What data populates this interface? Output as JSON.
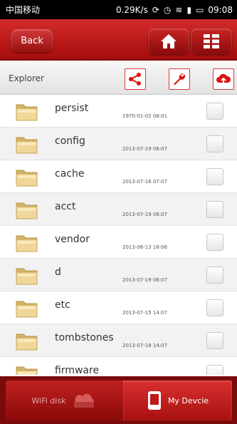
{
  "status_bar": {
    "carrier": "中国移动",
    "net_speed": "0.29K/s",
    "time": "09:08"
  },
  "header": {
    "back_label": "Back",
    "home_icon": "home-icon",
    "grid_icon": "grid-icon"
  },
  "toolbar": {
    "title": "Explorer",
    "share_icon": "share-icon",
    "tools_icon": "wrench-icon",
    "upload_icon": "cloud-upload-icon"
  },
  "files": [
    {
      "name": "persist",
      "date": "1970-01-02 08:01"
    },
    {
      "name": "config",
      "date": "2013-07-19 06:07"
    },
    {
      "name": "cache",
      "date": "2013-07-16 07:07"
    },
    {
      "name": "acct",
      "date": "2013-07-19 06:07"
    },
    {
      "name": "vendor",
      "date": "2013-06-13 18:06"
    },
    {
      "name": "d",
      "date": "2013-07-19 06:07"
    },
    {
      "name": "etc",
      "date": "2013-07-15 14:07"
    },
    {
      "name": "tombstones",
      "date": "2013-07-18 14:07"
    },
    {
      "name": "firmware",
      "date": ""
    }
  ],
  "bottom_tabs": {
    "wifi_disk": "WiFi disk",
    "my_device": "My Devcie"
  },
  "colors": {
    "brand_red": "#b81818",
    "dark_red": "#7b0b0b"
  }
}
